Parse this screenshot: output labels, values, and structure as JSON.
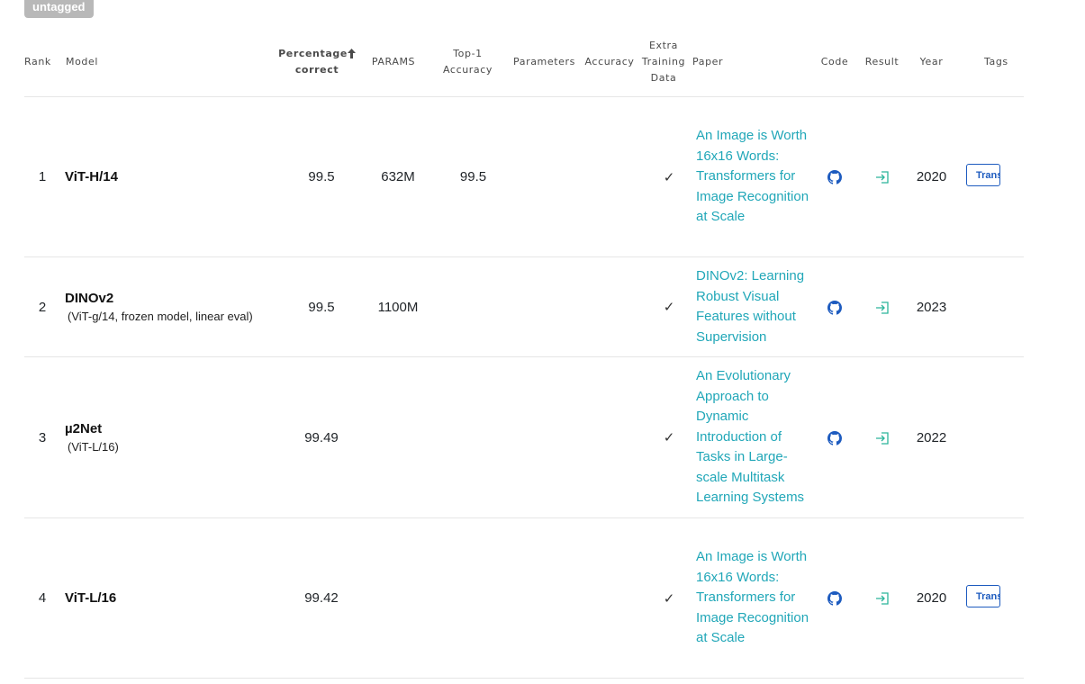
{
  "badge": "untagged",
  "headers": {
    "rank": "Rank",
    "model": "Model",
    "pct_line1": "Percentage",
    "pct_line2": "correct",
    "params": "PARAMS",
    "top1_line1": "Top-1",
    "top1_line2": "Accuracy",
    "parameters": "Parameters",
    "accuracy": "Accuracy",
    "extra_line1": "Extra",
    "extra_line2": "Training",
    "extra_line3": "Data",
    "paper": "Paper",
    "code": "Code",
    "result": "Result",
    "year": "Year",
    "tags": "Tags"
  },
  "rows": [
    {
      "rank": "1",
      "model": "ViT-H/14",
      "sub": "",
      "pct": "99.5",
      "params": "632M",
      "top1": "99.5",
      "parameters": "",
      "accuracy": "",
      "extra": "✓",
      "paper": "An Image is Worth 16x16 Words: Transformers for Image Recognition at Scale",
      "year": "2020",
      "tag": "Transformer"
    },
    {
      "rank": "2",
      "model": "DINOv2",
      "sub": "(ViT-g/14, frozen model, linear eval)",
      "pct": "99.5",
      "params": "1100M",
      "top1": "",
      "parameters": "",
      "accuracy": "",
      "extra": "✓",
      "paper": "DINOv2: Learning Robust Visual Features without Supervision",
      "year": "2023",
      "tag": ""
    },
    {
      "rank": "3",
      "model": "µ2Net",
      "sub": "(ViT-L/16)",
      "pct": "99.49",
      "params": "",
      "top1": "",
      "parameters": "",
      "accuracy": "",
      "extra": "✓",
      "paper": "An Evolutionary Approach to Dynamic Introduction of Tasks in Large-scale Multitask Learning Systems",
      "year": "2022",
      "tag": ""
    },
    {
      "rank": "4",
      "model": "ViT-L/16",
      "sub": "",
      "pct": "99.42",
      "params": "",
      "top1": "",
      "parameters": "",
      "accuracy": "",
      "extra": "✓",
      "paper": "An Image is Worth 16x16 Words: Transformers for Image Recognition at Scale",
      "year": "2020",
      "tag": "Transformer"
    }
  ],
  "colors": {
    "link": "#21a7b8",
    "github_icon": "#1d5bbf",
    "result_icon": "#2bb59a",
    "tag_border": "#1d5bbf",
    "badge_bg": "#b8b8b8"
  },
  "icons": {
    "code": "github-icon",
    "result": "enter-arrow-icon",
    "sort": "sort-arrow-up-icon"
  }
}
